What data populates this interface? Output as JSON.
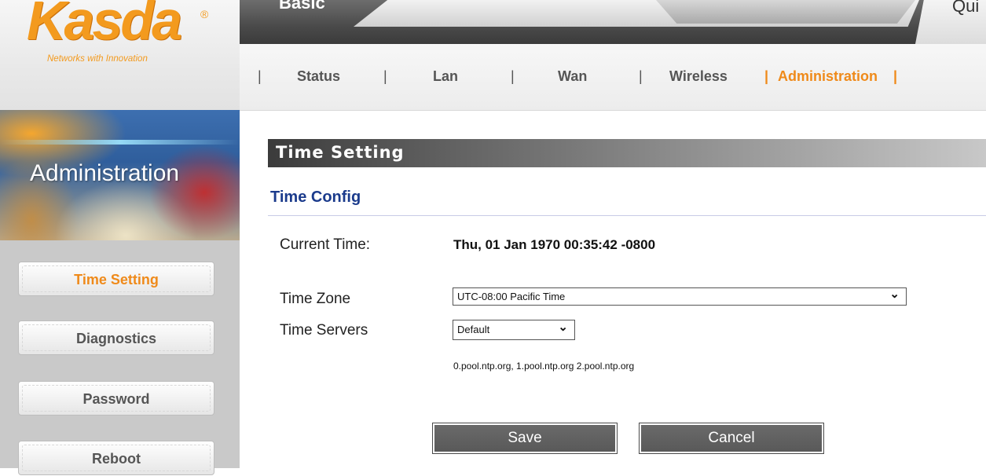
{
  "brand": {
    "logo_text": "Kasda",
    "registered_mark": "®",
    "tagline": "Networks with Innovation",
    "accent_color": "#ef8a1a"
  },
  "top_tabs": {
    "basic_label": "Basic",
    "quick_label": "Qui"
  },
  "nav": {
    "items": [
      "Status",
      "Lan",
      "Wan",
      "Wireless",
      "Administration"
    ],
    "active": "Administration",
    "separator": "|"
  },
  "sidebar": {
    "title": "Administration",
    "items": [
      "Time Setting",
      "Diagnostics",
      "Password",
      "Reboot"
    ],
    "active": "Time Setting"
  },
  "main": {
    "section_title": "Time Setting",
    "subsection_title": "Time Config",
    "current_time_label": "Current Time:",
    "current_time_value": "Thu, 01 Jan 1970 00:35:42 -0800",
    "time_zone_label": "Time Zone",
    "time_zone_value": "UTC-08:00 Pacific Time",
    "time_servers_label": "Time Servers",
    "time_servers_value": "Default",
    "ntp_servers_text": "0.pool.ntp.org, 1.pool.ntp.org 2.pool.ntp.org",
    "save_label": "Save",
    "cancel_label": "Cancel",
    "chevron_icon": "chevron-down-icon"
  }
}
